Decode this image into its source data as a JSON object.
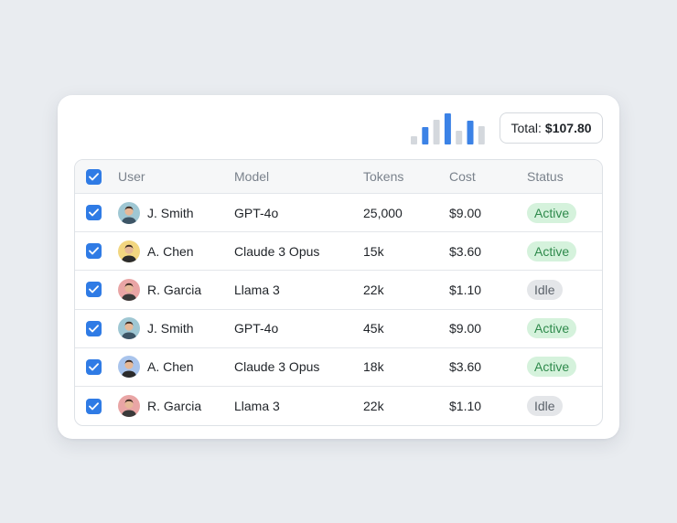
{
  "summary": {
    "total_label": "Total:",
    "total_value": "$107.80"
  },
  "sparkline": {
    "bars": [
      {
        "level": 0.25,
        "color": "#d4d8dd"
      },
      {
        "level": 0.55,
        "color": "#3b82e6"
      },
      {
        "level": 0.8,
        "color": "#d4d8dd"
      },
      {
        "level": 1.0,
        "color": "#3b82e6"
      },
      {
        "level": 0.45,
        "color": "#d4d8dd"
      },
      {
        "level": 0.75,
        "color": "#3b82e6"
      },
      {
        "level": 0.6,
        "color": "#d4d8dd"
      }
    ]
  },
  "table": {
    "columns": {
      "user": "User",
      "model": "Model",
      "tokens": "Tokens",
      "cost": "Cost",
      "status": "Status"
    },
    "rows": [
      {
        "user": "J. Smith",
        "model": "GPT-4o",
        "tokens": "25,000",
        "cost": "$9.00",
        "status": "Active",
        "avatar_bg": "#9fc7d3",
        "avatar_shirt": "#3d5566"
      },
      {
        "user": "A. Chen",
        "model": "Claude 3 Opus",
        "tokens": "15k",
        "cost": "$3.60",
        "status": "Active",
        "avatar_bg": "#f2d680",
        "avatar_shirt": "#2b2b2b"
      },
      {
        "user": "R. Garcia",
        "model": "Llama 3",
        "tokens": "22k",
        "cost": "$1.10",
        "status": "Idle",
        "avatar_bg": "#e9a5a5",
        "avatar_shirt": "#3a3a3a"
      },
      {
        "user": "J. Smith",
        "model": "GPT-4o",
        "tokens": "45k",
        "cost": "$9.00",
        "status": "Active",
        "avatar_bg": "#9fc7d3",
        "avatar_shirt": "#3d5566"
      },
      {
        "user": "A. Chen",
        "model": "Claude 3 Opus",
        "tokens": "18k",
        "cost": "$3.60",
        "status": "Active",
        "avatar_bg": "#a9c4ec",
        "avatar_shirt": "#2b2b2b"
      },
      {
        "user": "R. Garcia",
        "model": "Llama 3",
        "tokens": "22k",
        "cost": "$1.10",
        "status": "Idle",
        "avatar_bg": "#e9a5a5",
        "avatar_shirt": "#3a3a3a"
      }
    ]
  },
  "colors": {
    "accent": "#2f7be5",
    "active_bg": "#d5f2dc",
    "active_fg": "#2f8a4c",
    "idle_bg": "#e4e6e9",
    "idle_fg": "#5c636b"
  }
}
